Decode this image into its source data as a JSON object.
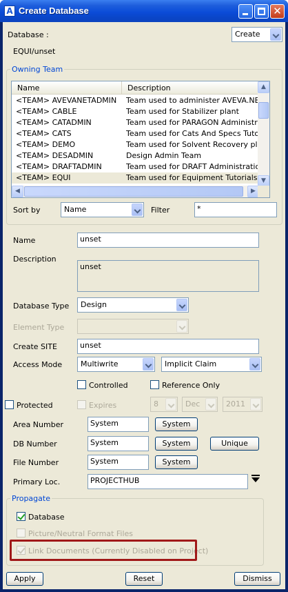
{
  "window": {
    "title": "Create Database",
    "app_icon": "aveva-app-icon"
  },
  "database": {
    "label": "Database :",
    "mode_value": "Create",
    "path": "EQUI/unset"
  },
  "owning_team": {
    "title": "Owning Team",
    "columns": [
      "Name",
      "Description"
    ],
    "rows": [
      {
        "name": "<TEAM>  AVEVANETADMIN",
        "description": "Team used to administer AVEVA.NET G"
      },
      {
        "name": "<TEAM>  CABLE",
        "description": "Team used for Stabilizer plant"
      },
      {
        "name": "<TEAM>  CATADMIN",
        "description": "Team used for PARAGON Administratio"
      },
      {
        "name": "<TEAM>  CATS",
        "description": "Team used for Cats And Specs Tutorial"
      },
      {
        "name": "<TEAM>  DEMO",
        "description": "Team used for Solvent Recovery plant"
      },
      {
        "name": "<TEAM>  DESADMIN",
        "description": "Design Admin Team"
      },
      {
        "name": "<TEAM>  DRAFTADMIN",
        "description": "Team used for DRAFT Administration da"
      },
      {
        "name": "<TEAM>  EQUI",
        "description": "Team used for Equipment Tutorials"
      }
    ],
    "selected_row": 7,
    "sort_by_label": "Sort by",
    "sort_by_value": "Name",
    "filter_label": "Filter",
    "filter_value": "*"
  },
  "form": {
    "name_label": "Name",
    "name_value": "unset",
    "description_label": "Description",
    "description_value": "unset",
    "db_type_label": "Database Type",
    "db_type_value": "Design",
    "element_type_label": "Element Type",
    "element_type_value": "",
    "create_site_label": "Create SITE",
    "create_site_value": "unset",
    "access_mode_label": "Access Mode",
    "access_mode_value": "Multiwrite",
    "claim_value": "Implicit Claim",
    "controlled_label": "Controlled",
    "reference_only_label": "Reference Only",
    "protected_label": "Protected",
    "expires_label": "Expires",
    "expires_day": "8",
    "expires_month": "Dec",
    "expires_year": "2011",
    "area_number_label": "Area Number",
    "area_number_value": "System",
    "db_number_label": "DB Number",
    "db_number_value": "System",
    "file_number_label": "File Number",
    "file_number_value": "System",
    "system_button_label": "System",
    "unique_button_label": "Unique",
    "primary_loc_label": "Primary Loc.",
    "primary_loc_value": "PROJECTHUB"
  },
  "propagate": {
    "title": "Propagate",
    "database_label": "Database",
    "database_checked": true,
    "picture_label": "Picture/Neutral Format Files",
    "picture_checked": false,
    "link_docs_label": "Link Documents (Currently Disabled on Project)",
    "link_docs_checked": true
  },
  "footer": {
    "apply_label": "Apply",
    "reset_label": "Reset",
    "dismiss_label": "Dismiss"
  },
  "colors": {
    "title_bar": "#0B4CD8",
    "dialog_bg": "#ECE9D8",
    "group_title": "#0046d5",
    "highlight": "#a01818"
  }
}
